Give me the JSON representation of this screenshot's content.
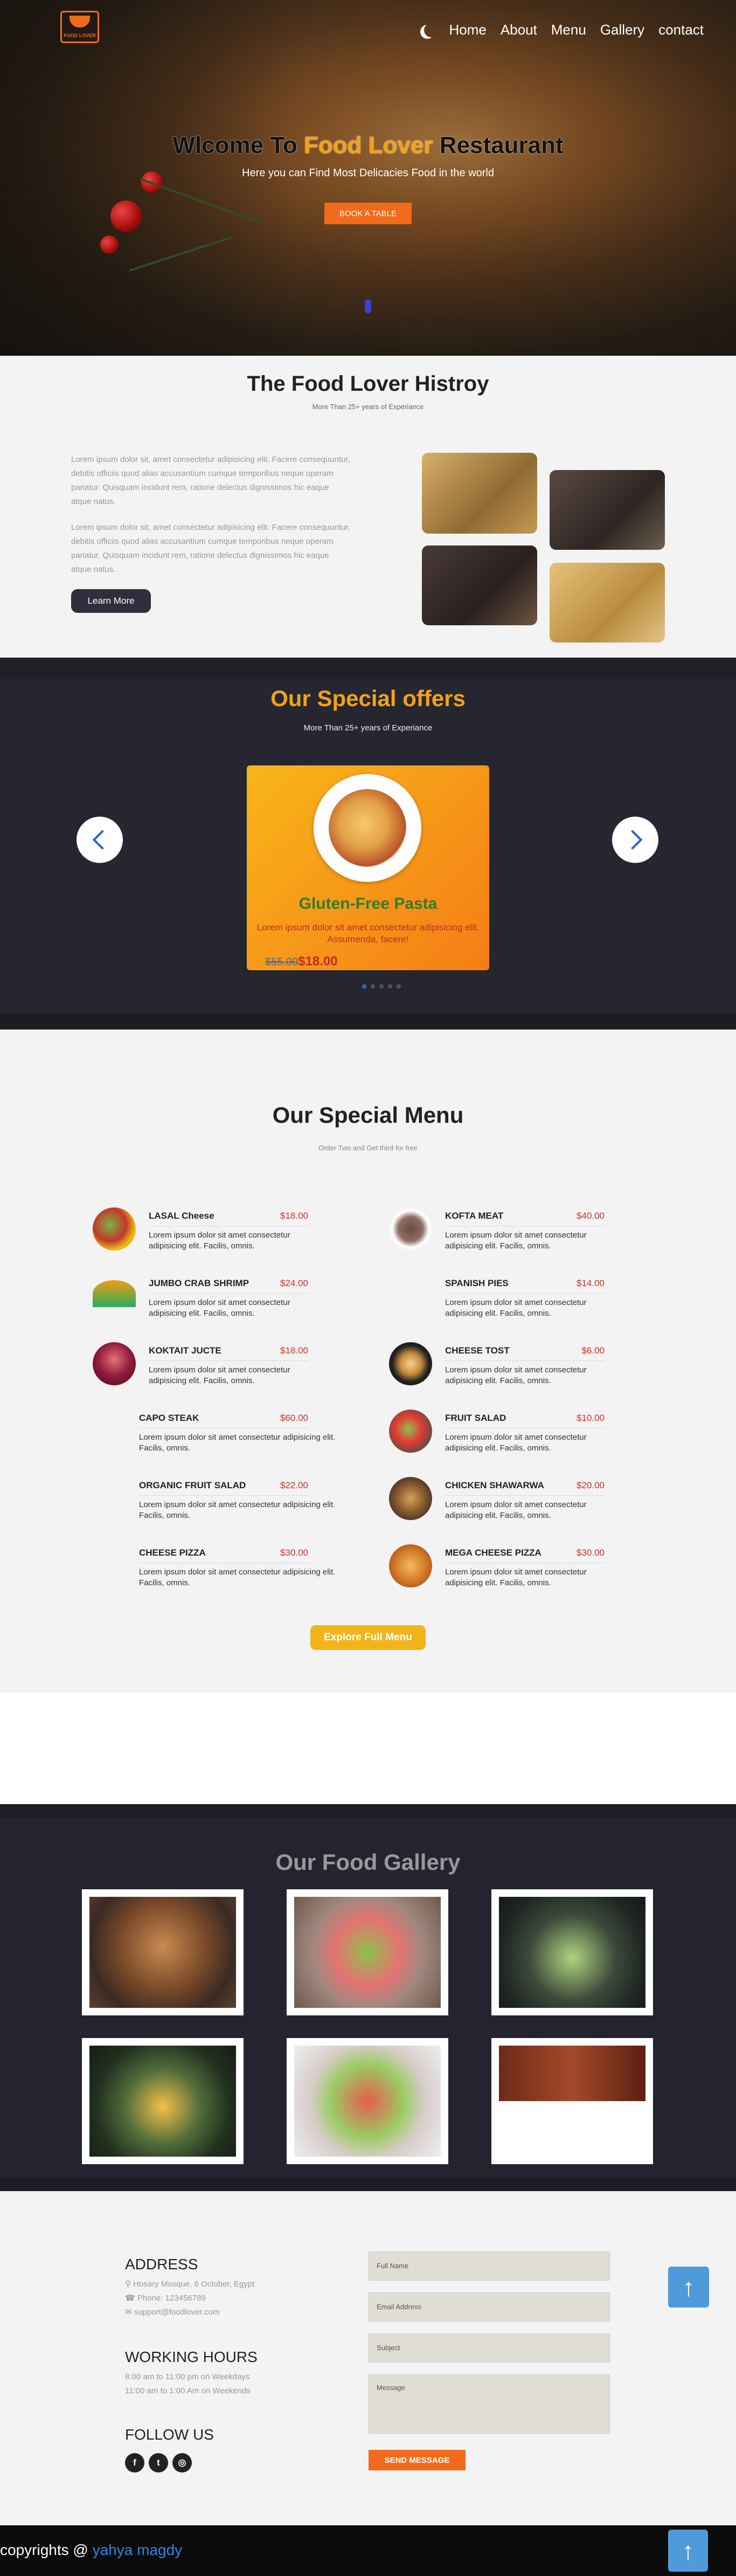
{
  "header": {
    "logo_text": "FOOD LOVER",
    "nav": [
      "Home",
      "About",
      "Menu",
      "Gallery",
      "contact"
    ]
  },
  "hero": {
    "title_pre": "Wlcome To ",
    "title_highlight": "Food Lover",
    "title_post": " Restaurant",
    "subtitle": "Here you can Find Most Delicacies Food in the world",
    "button": "BOOK A TABLE"
  },
  "history": {
    "title": "The Food Lover Histroy",
    "subtitle": "More Than 25+ years of Experiance",
    "paragraphs": [
      "Lorem ipsum dolor sit, amet consectetur adipisicing elit. Facere consequuntur, debitis officiis quod alias accusantium cumque temporibus neque operam pariatur. Quisquam incidunt rem, ratione delectus dignissimos hic eaque atque natus.",
      "Lorem ipsum dolor sit, amet consectetur adipisicing elit. Facere consequuntur, debitis officiis quod alias accusantium cumque temporibus neque operam pariatur. Quisquam incidunt rem, ratione delectus dignissimos hic eaque atque natus."
    ],
    "button": "Learn More"
  },
  "offers": {
    "title": "Our Special offers",
    "subtitle": "More Than 25+ years of Experiance",
    "card": {
      "name": "Gluten-Free Pasta",
      "desc": "Lorem ipsum dolor sit amet consectetur adipisicing elit. Assumenda, facere!",
      "old_price": "$55.00",
      "new_price": "$18.00"
    },
    "active_slide": 1,
    "slides": 5
  },
  "menu": {
    "title": "Our Special Menu",
    "subtitle": "Order Two and Get third for free",
    "items": [
      {
        "name": "LASAL Cheese",
        "price": "$18.00",
        "desc": "Lorem ipsum dolor sit amet consectetur adipisicing elit. Facilis, omnis."
      },
      {
        "name": "KOFTA MEAT",
        "price": "$40.00",
        "desc": "Lorem ipsum dolor sit amet consectetur adipisicing elit. Facilis, omnis."
      },
      {
        "name": "JUMBO CRAB SHRIMP",
        "price": "$24.00",
        "desc": "Lorem ipsum dolor sit amet consectetur adipisicing elit. Facilis, omnis."
      },
      {
        "name": "SPANISH PIES",
        "price": "$14.00",
        "desc": "Lorem ipsum dolor sit amet consectetur adipisicing elit. Facilis, omnis."
      },
      {
        "name": "KOKTAIT JUCTE",
        "price": "$18.00",
        "desc": "Lorem ipsum dolor sit amet consectetur adipisicing elit. Facilis, omnis."
      },
      {
        "name": "CHEESE TOST",
        "price": "$6.00",
        "desc": "Lorem ipsum dolor sit amet consectetur adipisicing elit. Facilis, omnis."
      },
      {
        "name": "CAPO STEAK",
        "price": "$60.00",
        "desc": "Lorem ipsum dolor sit amet consectetur adipisicing elit. Facilis, omnis."
      },
      {
        "name": "FRUIT SALAD",
        "price": "$10.00",
        "desc": "Lorem ipsum dolor sit amet consectetur adipisicing elit. Facilis, omnis."
      },
      {
        "name": "ORGANIC FRUIT SALAD",
        "price": "$22.00",
        "desc": "Lorem ipsum dolor sit amet consectetur adipisicing elit. Facilis, omnis."
      },
      {
        "name": "CHICKEN SHAWARWA",
        "price": "$20.00",
        "desc": "Lorem ipsum dolor sit amet consectetur adipisicing elit. Facilis, omnis."
      },
      {
        "name": "CHEESE PIZZA",
        "price": "$30.00",
        "desc": "Lorem ipsum dolor sit amet consectetur adipisicing elit. Facilis, omnis."
      },
      {
        "name": "MEGA CHEESE PIZZA",
        "price": "$30.00",
        "desc": "Lorem ipsum dolor sit amet consectetur adipisicing elit. Facilis, omnis."
      }
    ],
    "button": "Explore Full Menu"
  },
  "gallery": {
    "title": "Our Food Gallery"
  },
  "contact": {
    "address_title": "ADDRESS",
    "address_lines": [
      "Hosary Mosque, 6 October, Egypt",
      "Phone: 123456789",
      "support@foodlover.com"
    ],
    "hours_title": "WORKING HOURS",
    "hours_lines": [
      "8:00 am to 11:00 pm on Weekdays",
      "11:00 am to 1:00 Am on Weekends"
    ],
    "follow_title": "FOLLOW US",
    "fields": [
      "Full Name",
      "Email Address",
      "Subject",
      "Message"
    ],
    "send": "SEND MESSAGE"
  },
  "footer": {
    "copy": "copyrights @ ",
    "author": "yahya magdy"
  },
  "colors": {
    "accent": "#f26a1b",
    "gold": "#f2a217",
    "price": "#d32f2f",
    "link": "#2f86e8"
  }
}
